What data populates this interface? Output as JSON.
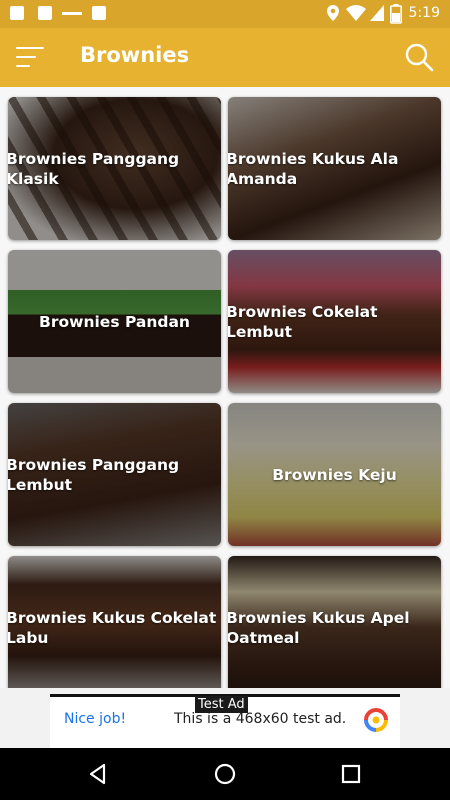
{
  "status_bar": {
    "time": "5:19"
  },
  "app_bar": {
    "title": "Brownies"
  },
  "cards": [
    {
      "title": "Brownies Panggang\nKlasik"
    },
    {
      "title": "Brownies Kukus Ala\nAmanda"
    },
    {
      "title": "Brownies Pandan"
    },
    {
      "title": "Brownies Cokelat Lembut"
    },
    {
      "title": "Brownies Panggang\nLembut"
    },
    {
      "title": "Brownies Keju"
    },
    {
      "title": "Brownies Kukus Cokelat\nLabu"
    },
    {
      "title": "Brownies Kukus Apel\nOatmeal"
    }
  ],
  "ad": {
    "label": "Test Ad",
    "left_text": "Nice job!",
    "body": "This is a 468x60 test ad."
  },
  "colors": {
    "accent": "#e6b22f",
    "status": "#d9a52b"
  },
  "icons": [
    "menu-icon",
    "search-icon",
    "location-icon",
    "wifi-icon",
    "signal-icon",
    "battery-icon",
    "back-icon",
    "home-icon",
    "recents-icon"
  ]
}
